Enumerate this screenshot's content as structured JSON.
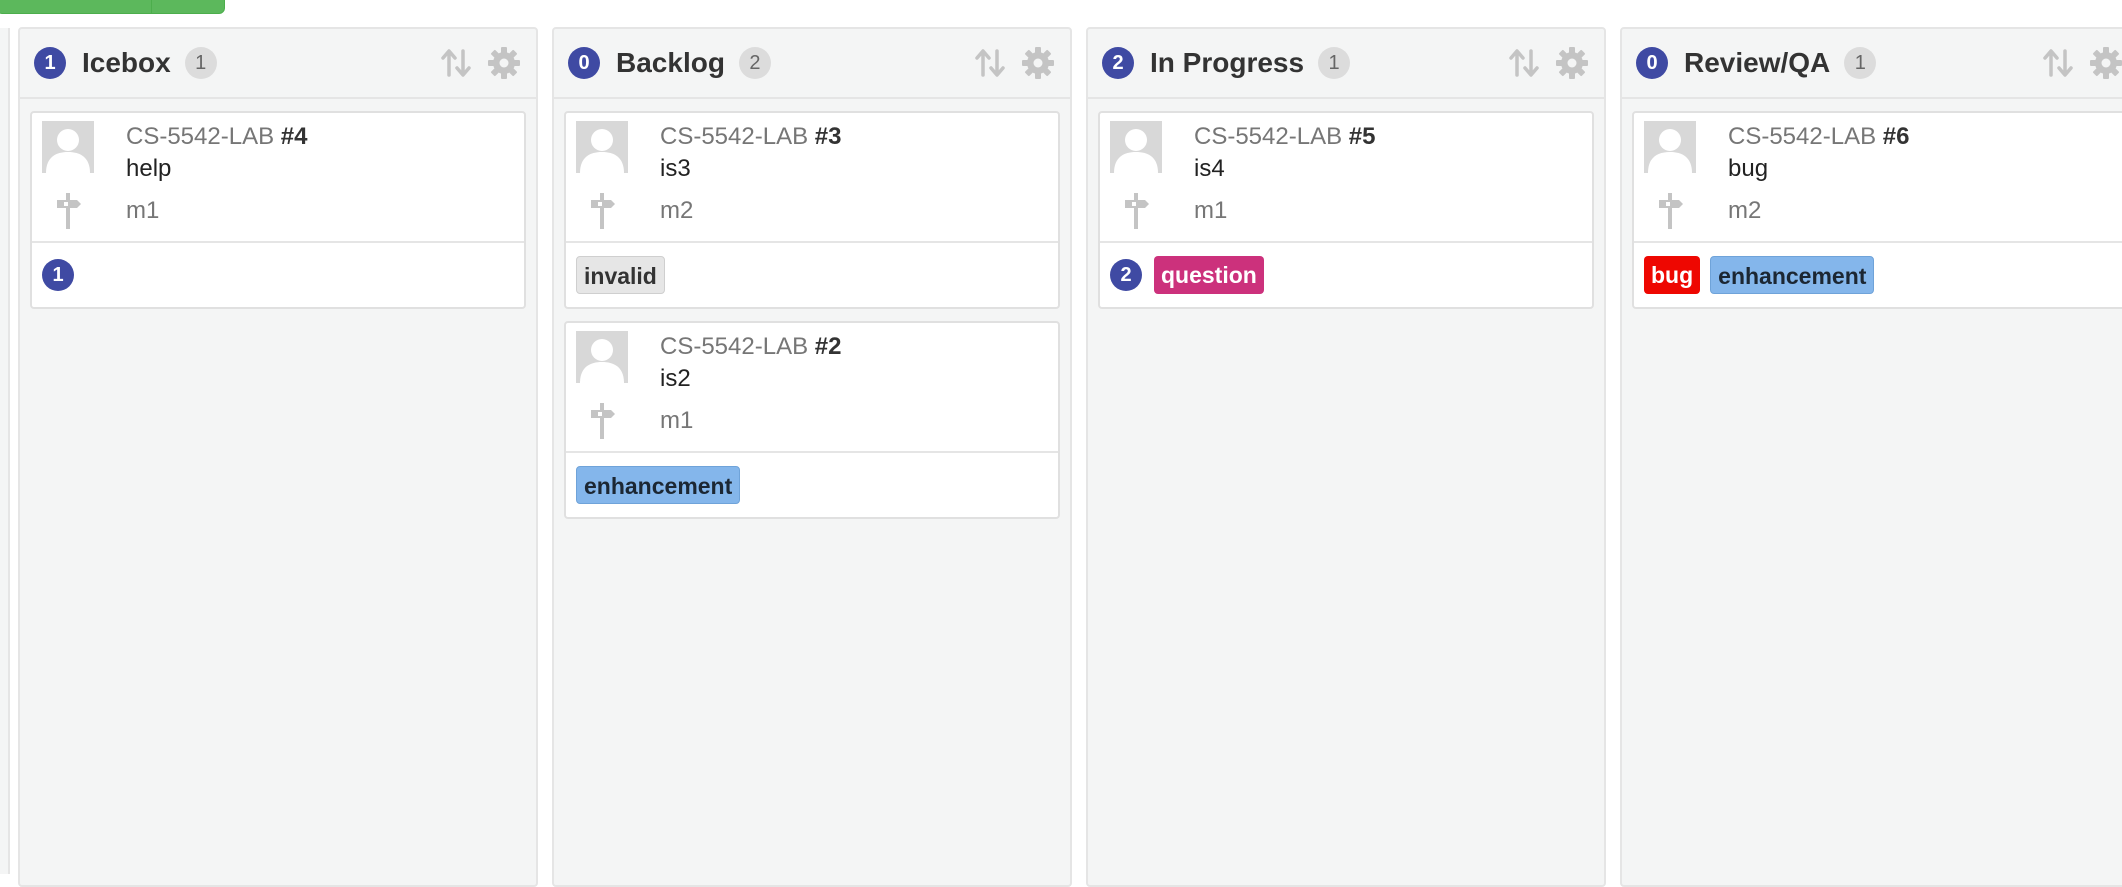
{
  "colors": {
    "badge": "#3f4aa3",
    "column_bg": "#f4f5f5",
    "top_button": "#5cb85c"
  },
  "icons": {
    "sort": "sort-arrows-icon",
    "settings": "gear-icon",
    "milestone": "milestone-signpost-icon",
    "avatar": "default-avatar-icon"
  },
  "columns": [
    {
      "badge": "1",
      "title": "Icebox",
      "count": "1",
      "cards": [
        {
          "repo": "CS-5542-LAB",
          "number": "#4",
          "title": "help",
          "milestone": "m1",
          "badge": "1",
          "labels": []
        }
      ]
    },
    {
      "badge": "0",
      "title": "Backlog",
      "count": "2",
      "cards": [
        {
          "repo": "CS-5542-LAB",
          "number": "#3",
          "title": "is3",
          "milestone": "m2",
          "labels": [
            {
              "name": "invalid",
              "bg": "#e6e6e6",
              "fg": "#333333"
            }
          ]
        },
        {
          "repo": "CS-5542-LAB",
          "number": "#2",
          "title": "is2",
          "milestone": "m1",
          "labels": [
            {
              "name": "enhancement",
              "bg": "#84b6eb",
              "fg": "#1c2733"
            }
          ]
        }
      ]
    },
    {
      "badge": "2",
      "title": "In Progress",
      "count": "1",
      "cards": [
        {
          "repo": "CS-5542-LAB",
          "number": "#5",
          "title": "is4",
          "milestone": "m1",
          "badge": "2",
          "labels": [
            {
              "name": "question",
              "bg": "#cc317c",
              "fg": "#ffffff"
            }
          ]
        }
      ]
    },
    {
      "badge": "0",
      "title": "Review/QA",
      "count": "1",
      "cards": [
        {
          "repo": "CS-5542-LAB",
          "number": "#6",
          "title": "bug",
          "milestone": "m2",
          "labels": [
            {
              "name": "bug",
              "bg": "#ee0701",
              "fg": "#ffffff"
            },
            {
              "name": "enhancement",
              "bg": "#84b6eb",
              "fg": "#1c2733"
            }
          ]
        }
      ]
    }
  ]
}
